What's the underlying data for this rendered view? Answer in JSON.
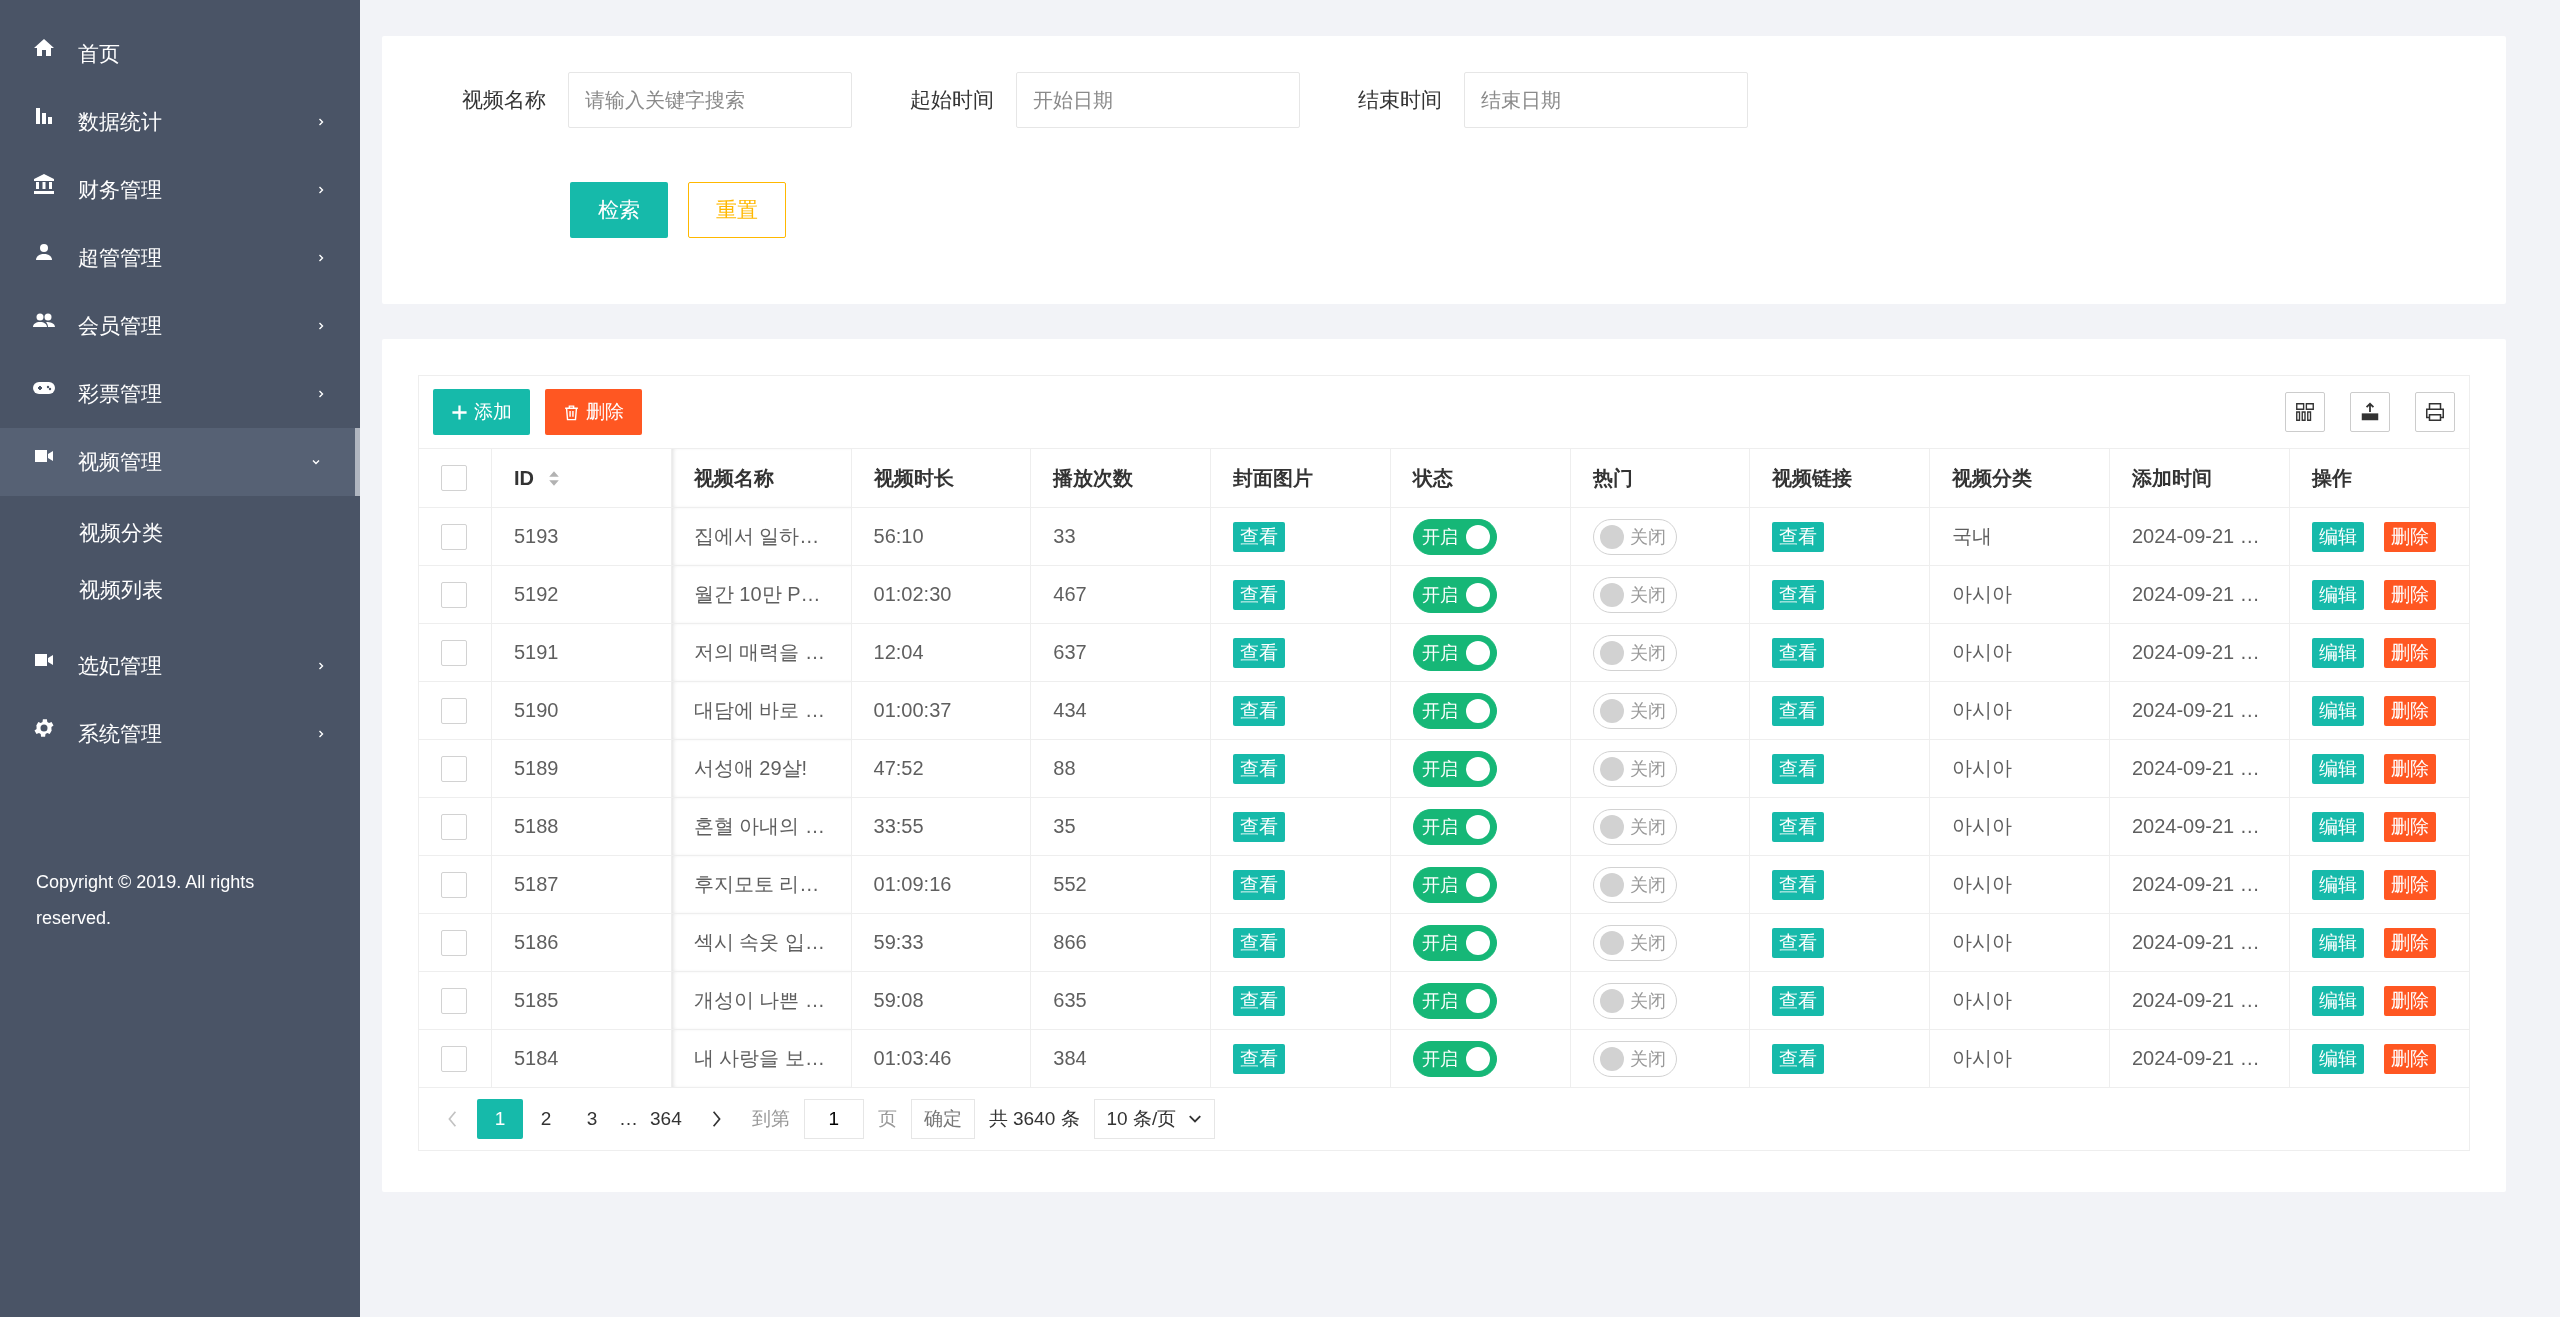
{
  "sidebar": {
    "items": [
      {
        "label": "首页",
        "kind": "link",
        "selected": false
      },
      {
        "label": "数据统计",
        "kind": "menu",
        "expanded": false,
        "selected": false
      },
      {
        "label": "财务管理",
        "kind": "menu",
        "expanded": false,
        "selected": false
      },
      {
        "label": "超管管理",
        "kind": "menu",
        "expanded": false,
        "selected": false
      },
      {
        "label": "会员管理",
        "kind": "menu",
        "expanded": false,
        "selected": false
      },
      {
        "label": "彩票管理",
        "kind": "menu",
        "expanded": false,
        "selected": false
      },
      {
        "label": "视频管理",
        "kind": "menu",
        "expanded": true,
        "selected": true,
        "children": [
          {
            "label": "视频分类"
          },
          {
            "label": "视频列表"
          }
        ]
      },
      {
        "label": "选妃管理",
        "kind": "menu",
        "expanded": false,
        "selected": false
      },
      {
        "label": "系统管理",
        "kind": "menu",
        "expanded": false,
        "selected": false
      }
    ],
    "copyright": "Copyright © 2019. All rights reserved."
  },
  "search": {
    "fields": [
      {
        "label": "视频名称",
        "placeholder": "请输入关键字搜索"
      },
      {
        "label": "起始时间",
        "placeholder": "开始日期"
      },
      {
        "label": "结束时间",
        "placeholder": "结束日期"
      }
    ],
    "buttons": {
      "search": "检索",
      "reset": "重置"
    }
  },
  "toolbar": {
    "add": "添加",
    "delete": "删除"
  },
  "table": {
    "select_all_checked": false,
    "columns": [
      "ID",
      "视频名称",
      "视频时长",
      "播放次数",
      "封面图片",
      "状态",
      "热门",
      "视频链接",
      "视频分类",
      "添加时间",
      "操作"
    ],
    "rows": [
      {
        "checked": false,
        "id": "5193",
        "name": "집에서 일하…",
        "duration": "56:10",
        "plays": "33",
        "cover": "查看",
        "status": {
          "on": true,
          "label": "开启"
        },
        "hot": {
          "on": false,
          "label": "关闭"
        },
        "link": "查看",
        "category": "국내",
        "time": "2024-09-21 …",
        "edit": "编辑",
        "delete": "删除"
      },
      {
        "checked": false,
        "id": "5192",
        "name": "월간 10만 P…",
        "duration": "01:02:30",
        "plays": "467",
        "cover": "查看",
        "status": {
          "on": true,
          "label": "开启"
        },
        "hot": {
          "on": false,
          "label": "关闭"
        },
        "link": "查看",
        "category": "아시아",
        "time": "2024-09-21 …",
        "edit": "编辑",
        "delete": "删除"
      },
      {
        "checked": false,
        "id": "5191",
        "name": "저의 매력을 …",
        "duration": "12:04",
        "plays": "637",
        "cover": "查看",
        "status": {
          "on": true,
          "label": "开启"
        },
        "hot": {
          "on": false,
          "label": "关闭"
        },
        "link": "查看",
        "category": "아시아",
        "time": "2024-09-21 …",
        "edit": "编辑",
        "delete": "删除"
      },
      {
        "checked": false,
        "id": "5190",
        "name": "대담에 바로 …",
        "duration": "01:00:37",
        "plays": "434",
        "cover": "查看",
        "status": {
          "on": true,
          "label": "开启"
        },
        "hot": {
          "on": false,
          "label": "关闭"
        },
        "link": "查看",
        "category": "아시아",
        "time": "2024-09-21 …",
        "edit": "编辑",
        "delete": "删除"
      },
      {
        "checked": false,
        "id": "5189",
        "name": "서성애 29살!",
        "duration": "47:52",
        "plays": "88",
        "cover": "查看",
        "status": {
          "on": true,
          "label": "开启"
        },
        "hot": {
          "on": false,
          "label": "关闭"
        },
        "link": "查看",
        "category": "아시아",
        "time": "2024-09-21 …",
        "edit": "编辑",
        "delete": "删除"
      },
      {
        "checked": false,
        "id": "5188",
        "name": "혼혈 아내의 …",
        "duration": "33:55",
        "plays": "35",
        "cover": "查看",
        "status": {
          "on": true,
          "label": "开启"
        },
        "hot": {
          "on": false,
          "label": "关闭"
        },
        "link": "查看",
        "category": "아시아",
        "time": "2024-09-21 …",
        "edit": "编辑",
        "delete": "删除"
      },
      {
        "checked": false,
        "id": "5187",
        "name": "후지모토 리…",
        "duration": "01:09:16",
        "plays": "552",
        "cover": "查看",
        "status": {
          "on": true,
          "label": "开启"
        },
        "hot": {
          "on": false,
          "label": "关闭"
        },
        "link": "查看",
        "category": "아시아",
        "time": "2024-09-21 …",
        "edit": "编辑",
        "delete": "删除"
      },
      {
        "checked": false,
        "id": "5186",
        "name": "섹시 속옷 입…",
        "duration": "59:33",
        "plays": "866",
        "cover": "查看",
        "status": {
          "on": true,
          "label": "开启"
        },
        "hot": {
          "on": false,
          "label": "关闭"
        },
        "link": "查看",
        "category": "아시아",
        "time": "2024-09-21 …",
        "edit": "编辑",
        "delete": "删除"
      },
      {
        "checked": false,
        "id": "5185",
        "name": "개성이 나쁜 …",
        "duration": "59:08",
        "plays": "635",
        "cover": "查看",
        "status": {
          "on": true,
          "label": "开启"
        },
        "hot": {
          "on": false,
          "label": "关闭"
        },
        "link": "查看",
        "category": "아시아",
        "time": "2024-09-21 …",
        "edit": "编辑",
        "delete": "删除"
      },
      {
        "checked": false,
        "id": "5184",
        "name": "내 사랑을 보…",
        "duration": "01:03:46",
        "plays": "384",
        "cover": "查看",
        "status": {
          "on": true,
          "label": "开启"
        },
        "hot": {
          "on": false,
          "label": "关闭"
        },
        "link": "查看",
        "category": "아시아",
        "time": "2024-09-21 …",
        "edit": "编辑",
        "delete": "删除"
      }
    ]
  },
  "pagination": {
    "pages": [
      {
        "kind": "page",
        "label": "1",
        "selected": true
      },
      {
        "kind": "page",
        "label": "2",
        "selected": false
      },
      {
        "kind": "page",
        "label": "3",
        "selected": false
      },
      {
        "kind": "ellipsis",
        "label": "…"
      },
      {
        "kind": "page",
        "label": "364",
        "selected": false
      }
    ],
    "goto_label": "到第",
    "goto_value": "1",
    "page_unit": "页",
    "confirm": "确定",
    "total": "共 3640 条",
    "page_size": "10 条/页"
  }
}
